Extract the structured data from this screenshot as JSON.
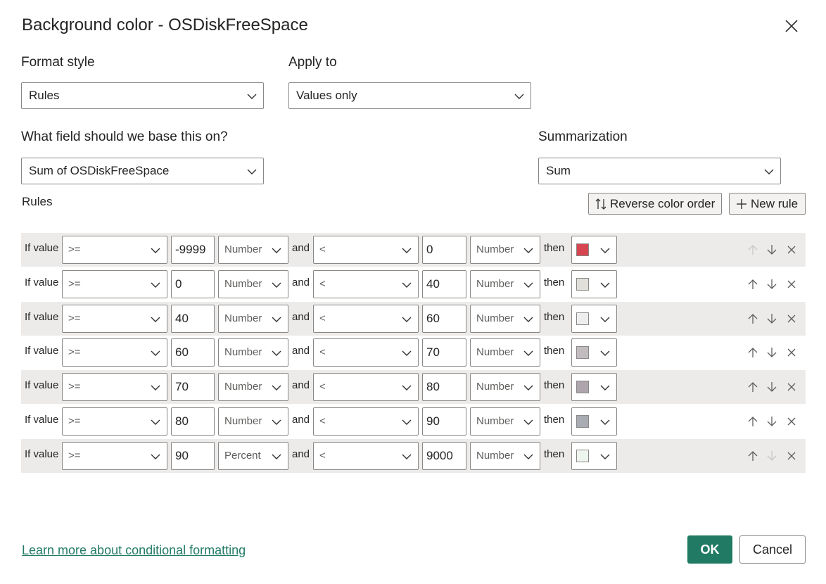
{
  "dialog": {
    "title": "Background color - OSDiskFreeSpace",
    "close_icon": "close-icon"
  },
  "format_style": {
    "label": "Format style",
    "value": "Rules"
  },
  "apply_to": {
    "label": "Apply to",
    "value": "Values only"
  },
  "field": {
    "label": "What field should we base this on?",
    "value": "Sum of OSDiskFreeSpace"
  },
  "summarization": {
    "label": "Summarization",
    "value": "Sum"
  },
  "rules": {
    "label": "Rules",
    "reverse_button": "Reverse color order",
    "new_rule_button": "New rule",
    "if_value_label": "If value",
    "and_label": "and",
    "then_label": "then",
    "items": [
      {
        "op1": ">=",
        "val1": "-9999",
        "type1": "Number",
        "op2": "<",
        "val2": "0",
        "type2": "Number",
        "color": "#d64550",
        "up_enabled": false,
        "down_enabled": true
      },
      {
        "op1": ">=",
        "val1": "0",
        "type1": "Number",
        "op2": "<",
        "val2": "40",
        "type2": "Number",
        "color": "#e1dfd9",
        "up_enabled": true,
        "down_enabled": true
      },
      {
        "op1": ">=",
        "val1": "40",
        "type1": "Number",
        "op2": "<",
        "val2": "60",
        "type2": "Number",
        "color": "#eeeeee",
        "up_enabled": true,
        "down_enabled": true
      },
      {
        "op1": ">=",
        "val1": "60",
        "type1": "Number",
        "op2": "<",
        "val2": "70",
        "type2": "Number",
        "color": "#c2bcc1",
        "up_enabled": true,
        "down_enabled": true
      },
      {
        "op1": ">=",
        "val1": "70",
        "type1": "Number",
        "op2": "<",
        "val2": "80",
        "type2": "Number",
        "color": "#ada5ab",
        "up_enabled": true,
        "down_enabled": true
      },
      {
        "op1": ">=",
        "val1": "80",
        "type1": "Number",
        "op2": "<",
        "val2": "90",
        "type2": "Number",
        "color": "#a9abb3",
        "up_enabled": true,
        "down_enabled": true
      },
      {
        "op1": ">=",
        "val1": "90",
        "type1": "Percent",
        "op2": "<",
        "val2": "9000",
        "type2": "Number",
        "color": "#eef4ee",
        "up_enabled": true,
        "down_enabled": false
      }
    ]
  },
  "footer": {
    "learn_more": "Learn more about conditional formatting",
    "ok": "OK",
    "cancel": "Cancel"
  },
  "colors": {
    "accent": "#217a63",
    "link": "#237b66",
    "row_shade": "#edebe9"
  }
}
